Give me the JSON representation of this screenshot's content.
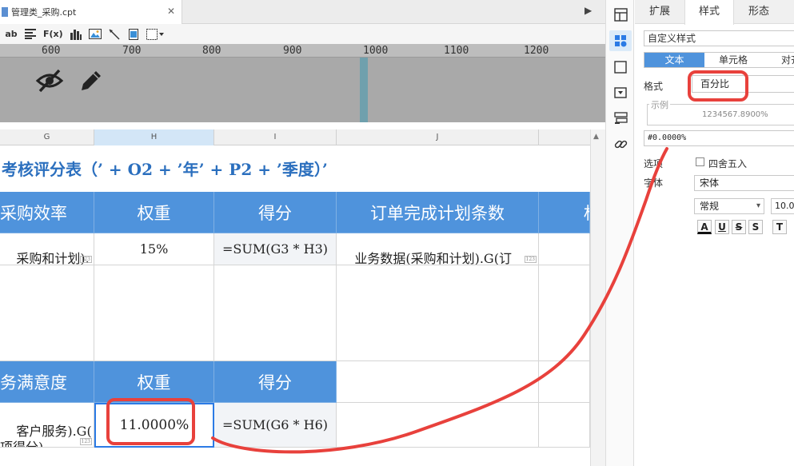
{
  "document": {
    "tab_title": "管理类_采购.cpt",
    "tab_close": "✕",
    "tab_menu": "▶"
  },
  "toolbar": {
    "text_tool": "ab",
    "formula_tool": "F(x)"
  },
  "ruler": {
    "labels": [
      "600",
      "700",
      "800",
      "900",
      "1000",
      "1100",
      "1200"
    ]
  },
  "columns": [
    "G",
    "H",
    "I",
    "J"
  ],
  "sheet": {
    "title": "考核评分表（’ + O2 + ’年’ + P2 + ’季度）’",
    "section1": {
      "headers": [
        "采购效率",
        "权重",
        "得分",
        "订单完成计划条数",
        "权"
      ],
      "row": [
        "采购和计划).\n采购效率)",
        "15%",
        "=SUM(G3 * H3)",
        "业务数据(采购和计划).G(订\n单完成计划条数)"
      ]
    },
    "section2": {
      "headers": [
        "务满意度",
        "权重",
        "得分"
      ],
      "row": [
        "客户服务).G(\n项得分)",
        "11.0000%",
        "=SUM(G6 * H6)"
      ]
    },
    "cell_tag": "123"
  },
  "side_icons": [
    "layout-icon",
    "cell-attribute-icon",
    "widget-icon",
    "dropdown-icon",
    "element-icon",
    "link-icon"
  ],
  "panel": {
    "tabs": [
      "扩展",
      "样式",
      "形态"
    ],
    "active_tab": "样式",
    "style_select": "自定义样式",
    "subtabs": [
      "文本",
      "单元格",
      "对齐"
    ],
    "format_label": "格式",
    "format_value": "百分比",
    "sample_legend": "示例",
    "sample_value": "1234567.8900%",
    "pattern_value": "#0.0000%",
    "options_label": "选项",
    "round_label": "四舍五入",
    "font_label": "字体",
    "font_value": "宋体",
    "weight_value": "常规",
    "weight_arrow": "▾",
    "size_value": "10.0",
    "format_buttons": [
      "A",
      "U",
      "S",
      "S",
      "T"
    ]
  },
  "annotation_color": "#e8413c",
  "accent_color": "#4f93dc"
}
